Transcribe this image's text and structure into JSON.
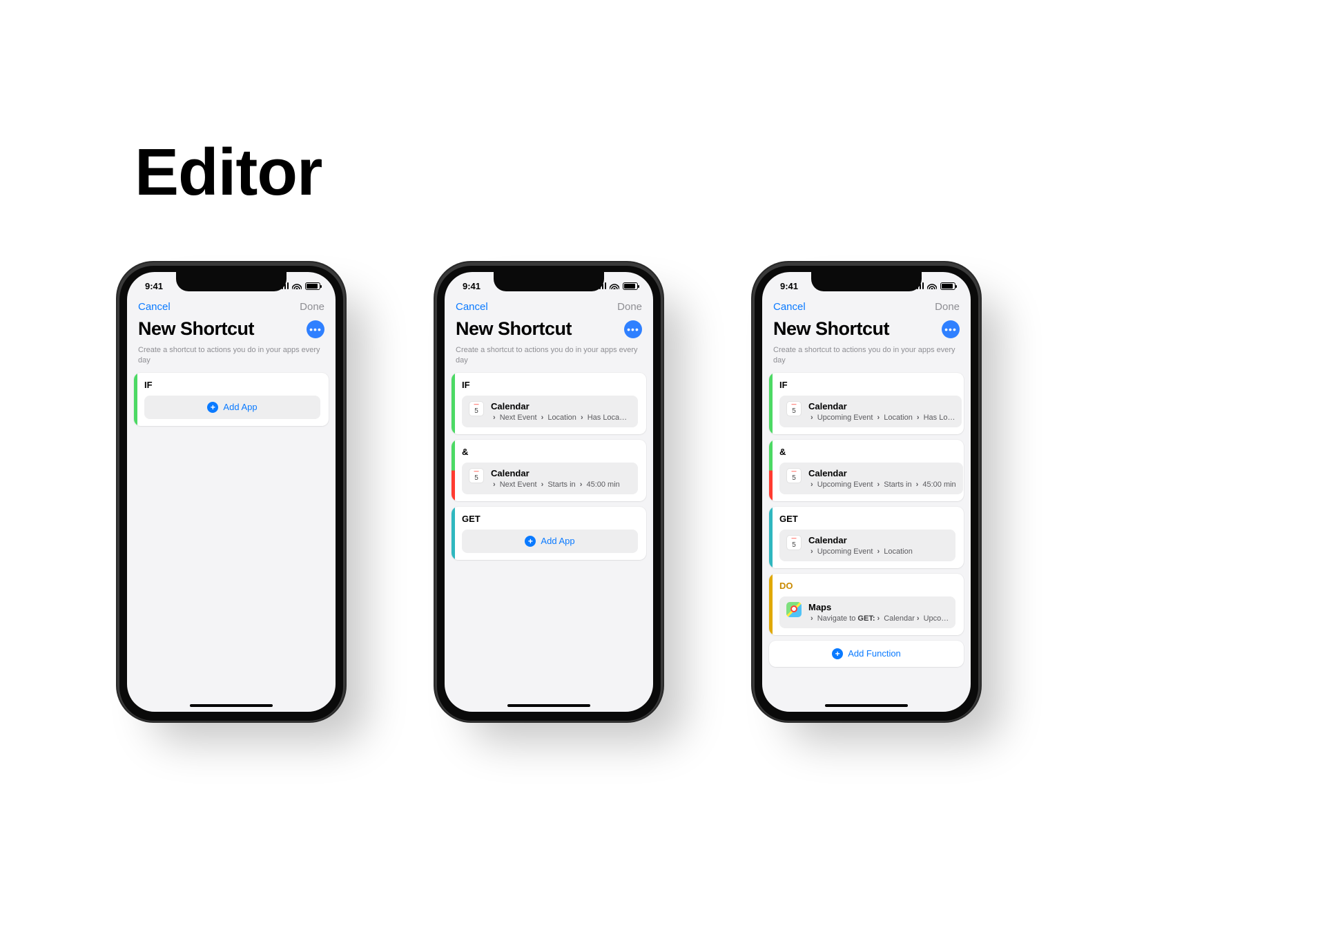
{
  "page_title": "Editor",
  "status_time": "9:41",
  "colors": {
    "link": "#0a7aff",
    "muted": "#8e8e93",
    "green": "#4cd964",
    "red": "#ff3b30",
    "orange": "#ff9500",
    "teal": "#2fb7bf",
    "gold": "#e0a800"
  },
  "common": {
    "cancel": "Cancel",
    "done": "Done",
    "title": "New Shortcut",
    "subtitle": "Create a shortcut to actions you do in your apps every day",
    "add_app": "Add App",
    "add_function": "Add Function",
    "more_icon": "ellipsis"
  },
  "phones": [
    {
      "cards": [
        {
          "label": "IF",
          "stripe": "green",
          "type": "add_app"
        }
      ]
    },
    {
      "cards": [
        {
          "label": "IF",
          "stripe": "green",
          "type": "app",
          "app": "Calendar",
          "icon": "calendar",
          "crumbs": [
            "Next Event",
            "Location",
            "Has Loca…"
          ]
        },
        {
          "label": "&",
          "stripe": "green-red",
          "type": "app",
          "app": "Calendar",
          "icon": "calendar",
          "crumbs": [
            "Next Event",
            "Starts in",
            "45:00 min"
          ]
        },
        {
          "label": "GET",
          "stripe": "teal",
          "type": "add_app"
        }
      ]
    },
    {
      "cards": [
        {
          "label": "IF",
          "stripe": "green",
          "type": "app",
          "app": "Calendar",
          "icon": "calendar",
          "crumbs": [
            "Upcoming Event",
            "Location",
            "Has Lo…"
          ]
        },
        {
          "label": "&",
          "stripe": "green-red",
          "type": "app",
          "app": "Calendar",
          "icon": "calendar",
          "crumbs": [
            "Upcoming Event",
            "Starts in",
            "45:00 min"
          ]
        },
        {
          "label": "GET",
          "stripe": "teal",
          "type": "app",
          "app": "Calendar",
          "icon": "calendar",
          "crumbs": [
            "Upcoming Event",
            "Location"
          ]
        },
        {
          "label": "DO",
          "stripe": "gold",
          "label_style": "gold",
          "type": "app",
          "app": "Maps",
          "icon": "maps",
          "crumbs_rich": [
            {
              "t": "Navigate to"
            },
            {
              "t": "GET:",
              "b": true
            },
            {
              "t": " Calendar"
            },
            {
              "t": "Upco…"
            }
          ]
        }
      ],
      "add_function": true
    }
  ]
}
